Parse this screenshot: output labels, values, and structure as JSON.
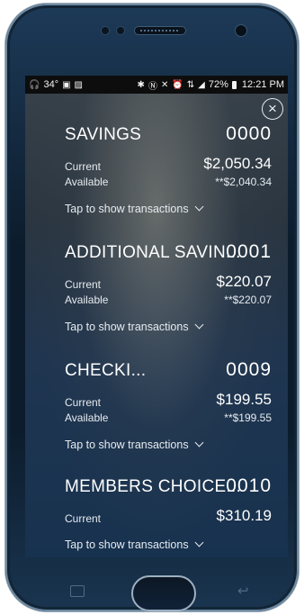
{
  "status_bar": {
    "left_icons": [
      "headphones-icon",
      "temperature",
      "image-icon",
      "photo-icon"
    ],
    "temperature": "34°",
    "right_icons": [
      "bluetooth-icon",
      "nfc-icon",
      "mute-icon",
      "alarm-icon",
      "network-icon",
      "signal-icon"
    ],
    "battery": "72%",
    "time": "12:21 PM"
  },
  "close_label": "×",
  "tap_label": "Tap to show transactions",
  "accounts": [
    {
      "name": "SAVINGS",
      "number": "0000",
      "current_label": "Current",
      "current": "$2,050.34",
      "available_label": "Available",
      "available": "**$2,040.34"
    },
    {
      "name": "ADDITIONAL SAVIN...",
      "number": "0001",
      "current_label": "Current",
      "current": "$220.07",
      "available_label": "Available",
      "available": "**$220.07"
    },
    {
      "name": "CHECKI...",
      "number": "0009",
      "current_label": "Current",
      "current": "$199.55",
      "available_label": "Available",
      "available": "**$199.55"
    },
    {
      "name": "MEMBERS CHOICE...",
      "number": "0010",
      "current_label": "Current",
      "current": "$310.19"
    }
  ]
}
